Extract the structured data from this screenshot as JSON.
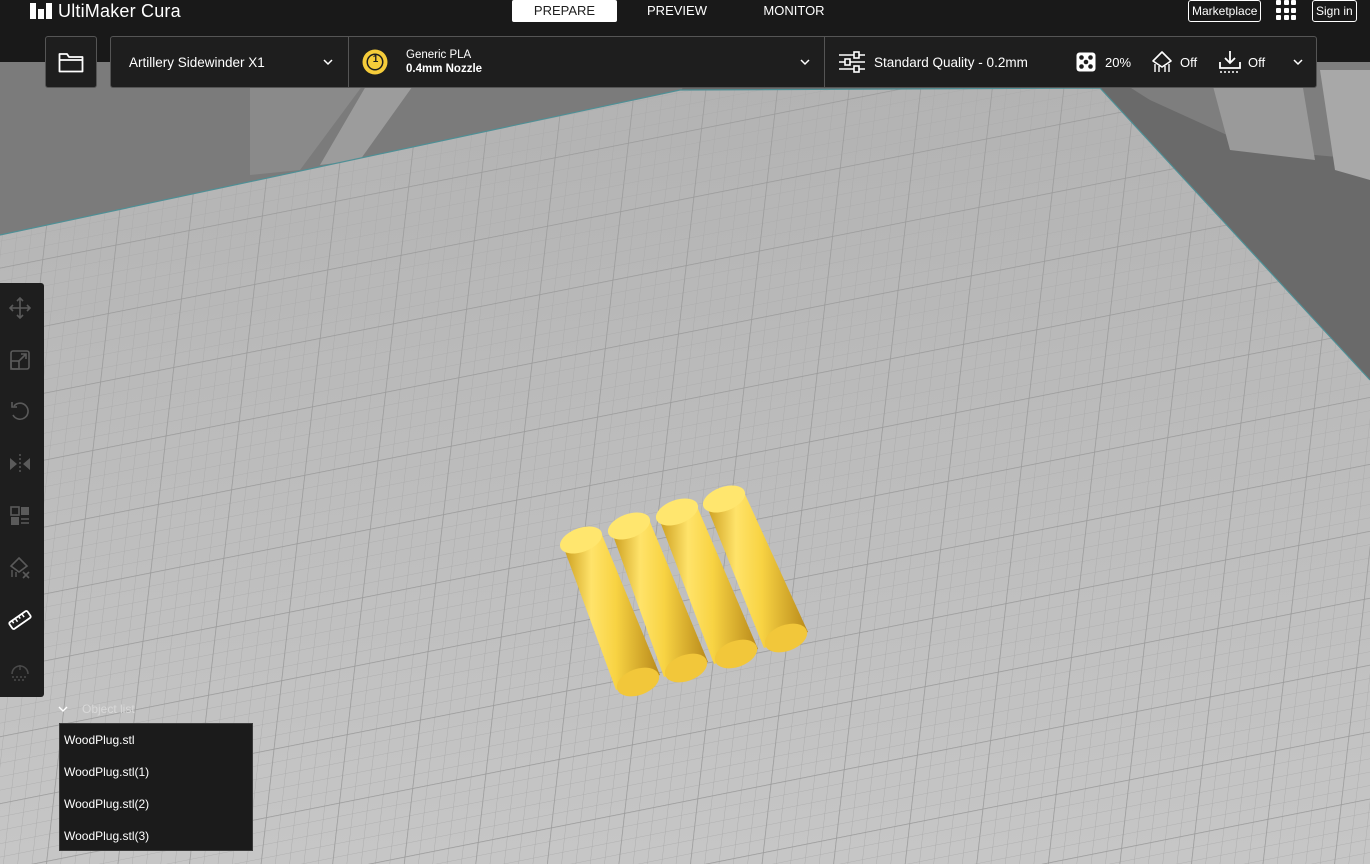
{
  "app": {
    "name": "UltiMaker Cura"
  },
  "stages": [
    {
      "label": "PREPARE",
      "active": true
    },
    {
      "label": "PREVIEW",
      "active": false
    },
    {
      "label": "MONITOR",
      "active": false
    }
  ],
  "top_right": {
    "marketplace": "Marketplace",
    "sign_in": "Sign in"
  },
  "printer": {
    "name": "Artillery Sidewinder X1"
  },
  "material": {
    "extruder_number": "1",
    "name": "Generic PLA",
    "nozzle": "0.4mm Nozzle",
    "color": "#f5cc3a"
  },
  "print_settings": {
    "profile": "Standard Quality - 0.2mm",
    "infill": "20%",
    "support": "Off",
    "adhesion": "Off"
  },
  "tools": [
    {
      "name": "move-tool-icon"
    },
    {
      "name": "scale-tool-icon"
    },
    {
      "name": "rotate-tool-icon"
    },
    {
      "name": "mirror-tool-icon"
    },
    {
      "name": "per-model-settings-icon"
    },
    {
      "name": "support-blocker-icon"
    },
    {
      "name": "measure-tool-icon",
      "active": true
    },
    {
      "name": "paint-tool-icon"
    }
  ],
  "object_list": {
    "title": "Object list",
    "items": [
      "WoodPlug.stl",
      "WoodPlug.stl(1)",
      "WoodPlug.stl(2)",
      "WoodPlug.stl(3)"
    ]
  },
  "colors": {
    "accent_model": "#f5cc3a",
    "buildplate": "#bdbdbd",
    "panel": "#1e1e1e"
  }
}
